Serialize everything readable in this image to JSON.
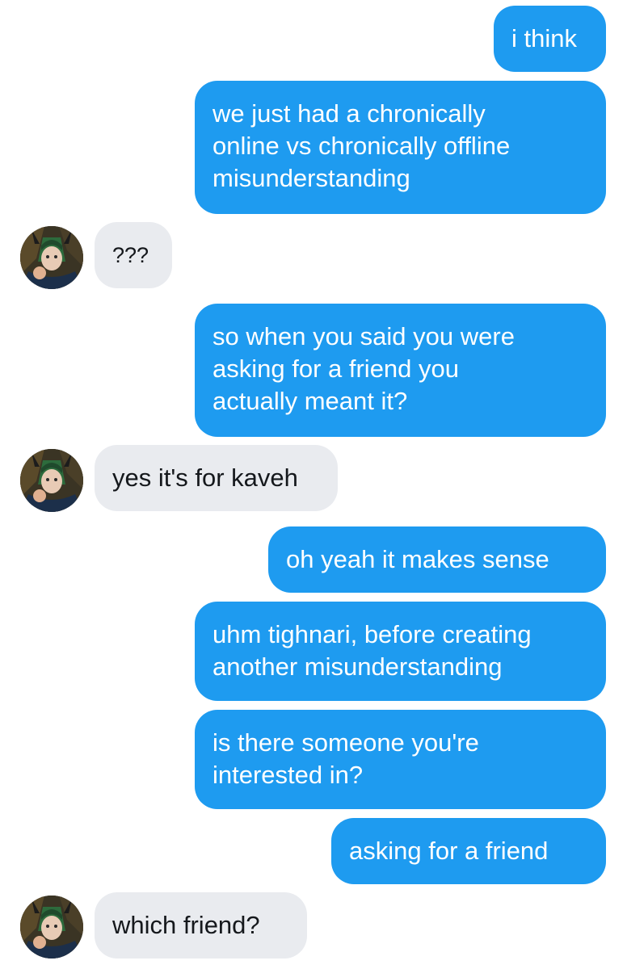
{
  "contact": {
    "avatar_icon": "contact-avatar-icon"
  },
  "messages": [
    {
      "direction": "outgoing",
      "text": "i think"
    },
    {
      "direction": "outgoing",
      "text": "we just had a chronically\nonline vs chronically offline\nmisunderstanding"
    },
    {
      "direction": "incoming",
      "text": "???"
    },
    {
      "direction": "outgoing",
      "text": "so when you said you were\nasking for a friend you\nactually meant it?"
    },
    {
      "direction": "incoming",
      "text": "yes it's for kaveh"
    },
    {
      "direction": "outgoing",
      "text": "oh yeah it makes sense"
    },
    {
      "direction": "outgoing",
      "text": "uhm tighnari, before creating\nanother misunderstanding"
    },
    {
      "direction": "outgoing",
      "text": "is there someone you're\ninterested in?"
    },
    {
      "direction": "outgoing",
      "text": "asking for a friend"
    },
    {
      "direction": "incoming",
      "text": "which friend?"
    }
  ],
  "colors": {
    "outgoing_bubble": "#1e9bf0",
    "incoming_bubble": "#e9ebef",
    "outgoing_text": "#ffffff",
    "incoming_text": "#15181c"
  }
}
